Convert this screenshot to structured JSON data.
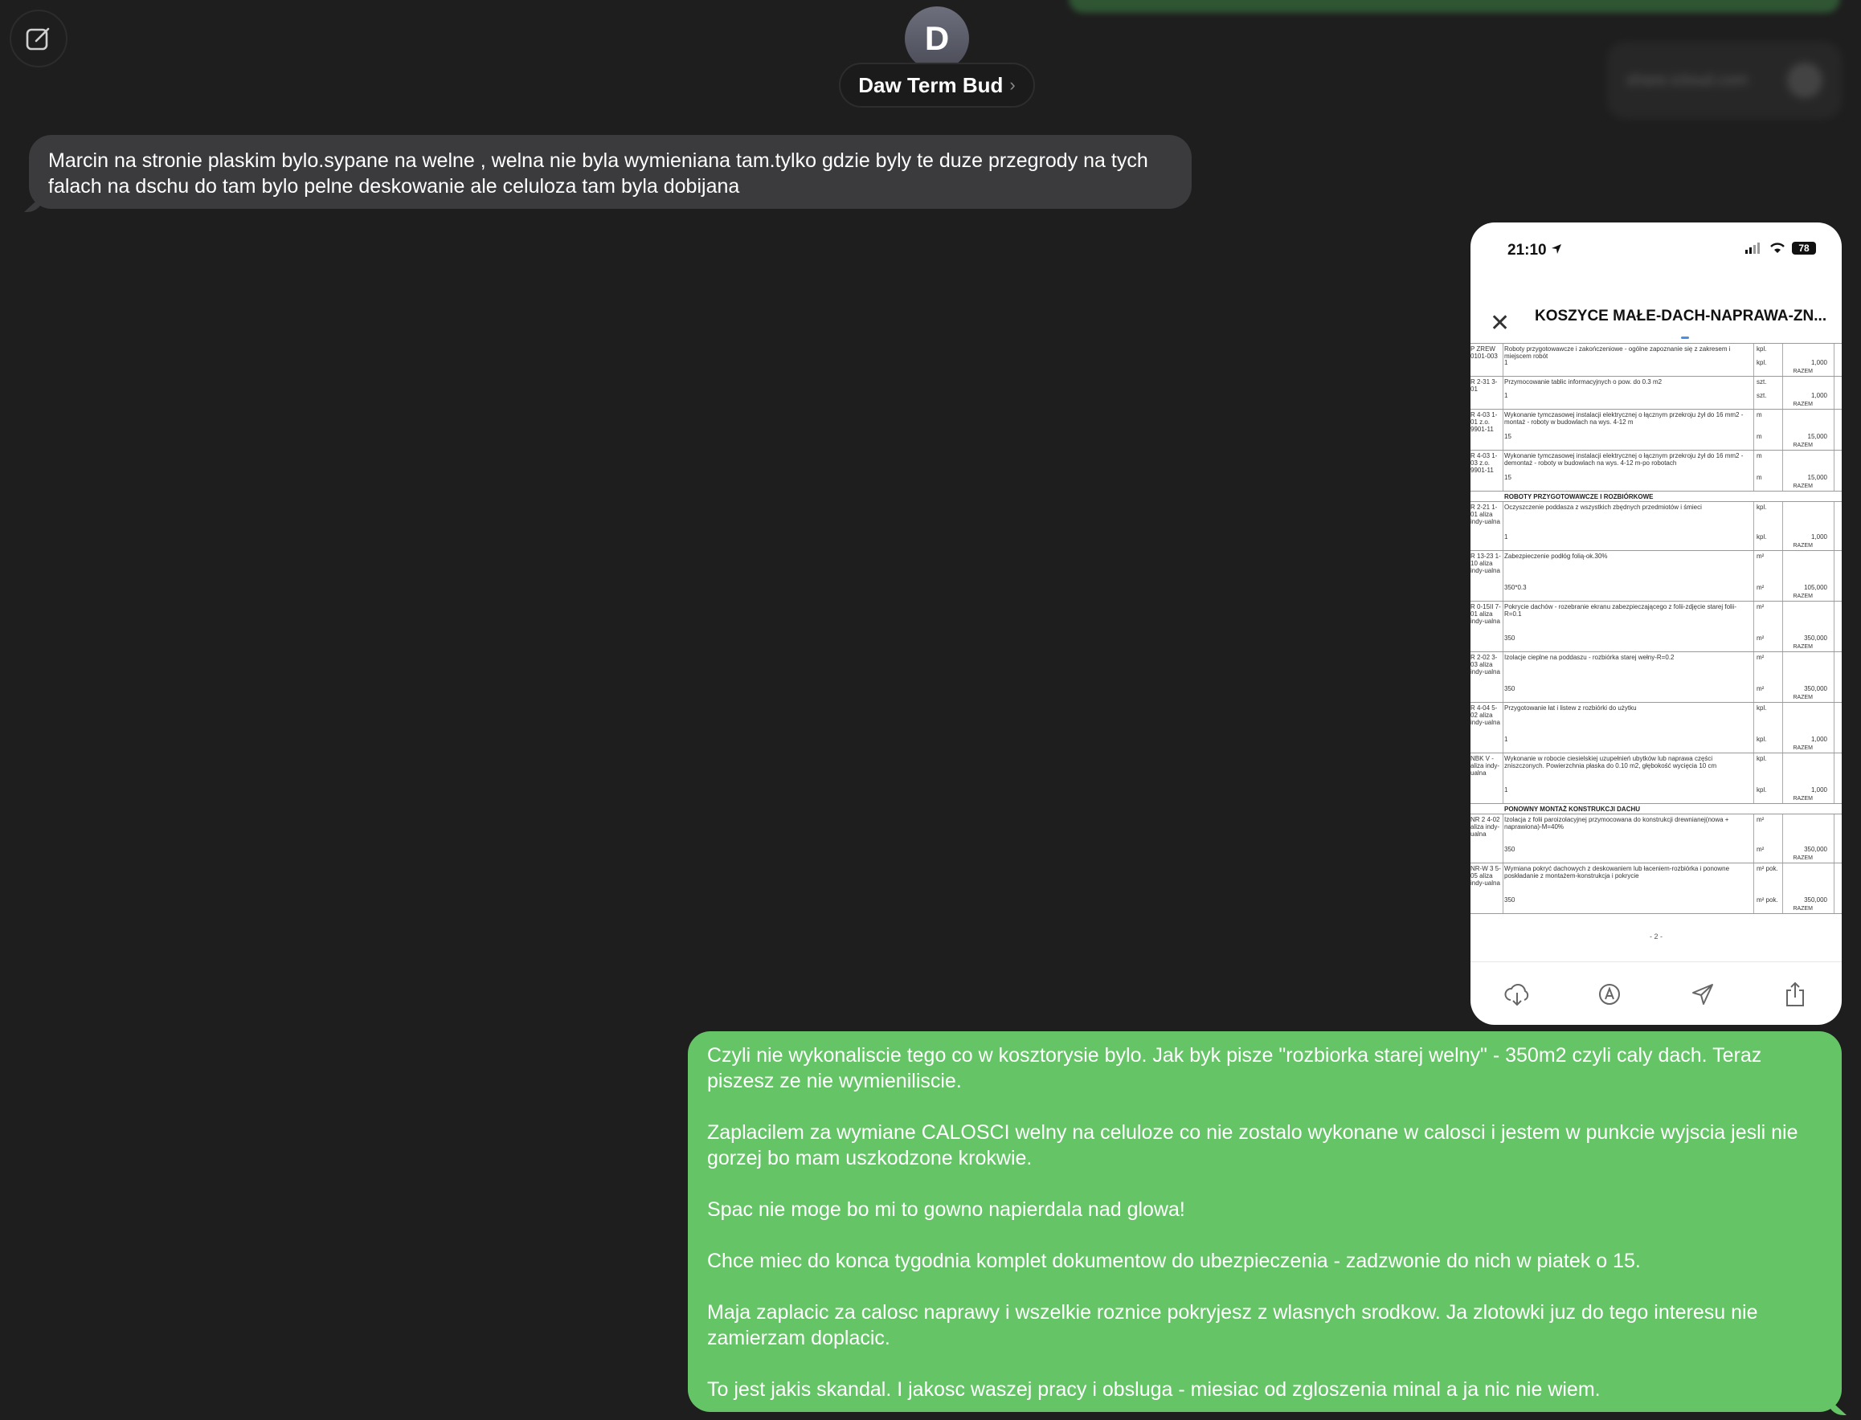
{
  "contact": {
    "initial": "D",
    "name": "Daw Term Bud",
    "chevron": "›"
  },
  "ghost": {
    "link_text": "share.icloud.com"
  },
  "messages": {
    "incoming": "Marcin na stronie plaskim bylo.sypane na welne , welna nie byla wymieniana tam.tylko gdzie byly te duze przegrody na tych falach na dschu do tam bylo pelne deskowanie ale celuloza tam byla dobijana",
    "outgoing": [
      "Czyli nie wykonaliscie tego co w kosztorysie bylo. Jak byk pisze \"rozbiorka starej welny\" - 350m2 czyli caly dach. Teraz piszesz ze nie wymieniliscie.",
      "Zaplacilem za wymiane CALOSCI welny na celuloze co nie zostalo wykonane w calosci i jestem w punkcie wyjscia jesli nie gorzej bo mam uszkodzone krokwie.",
      "Spac nie moge bo mi to gowno napierdala nad glowa!",
      "Chce miec do konca tygodnia komplet dokumentow do ubezpieczenia - zadzwonie do nich w piatek o 15.",
      "Maja zaplacic za calosc naprawy i wszelkie roznice pokryjesz z wlasnych srodkow. Ja zlotowki juz do tego interesu nie zamierzam doplacic.",
      "To jest jakis skandal. I jakosc waszej pracy i obsluga - miesiac od zgloszenia minal a ja nic nie wiem."
    ]
  },
  "phone": {
    "time": "21:10",
    "battery": "78",
    "doc_title": "KOSZYCE MAŁE-DACH-NAPRAWA-ZN...",
    "page_number": "- 2 -",
    "razem": "RAZEM",
    "rows": [
      {
        "code": "P ZREW 0101-003",
        "desc": "Roboty przygotowawcze i zakończeniowe - ogólne zapoznanie się z zakresem i miejscem robót",
        "unit": "kpl.",
        "base": "1",
        "qty": "1,000",
        "h": 40
      },
      {
        "code": "R 2-31 3-01",
        "desc": "Przymocowanie tablic informacyjnych o pow. do 0.3 m2",
        "unit": "szt.",
        "base": "1",
        "qty": "1,000",
        "h": 40
      },
      {
        "code": "R 4-03 1-01 z.o. 9901-11",
        "desc": "Wykonanie tymczasowej instalacji elektrycznej o łącznym przekroju żył do 16 mm2 - montaż - roboty w budowlach na wys. 4-12 m",
        "unit": "m",
        "base": "15",
        "qty": "15,000",
        "h": 50
      },
      {
        "code": "R 4-03 1-03 z.o. 9901-11",
        "desc": "Wykonanie tymczasowej instalacji elektrycznej o łącznym przekroju żył do 16 mm2 - demontaż - roboty w budowlach na wys. 4-12 m-po robotach",
        "unit": "m",
        "base": "15",
        "qty": "15,000",
        "h": 50
      }
    ],
    "section_1": "ROBOTY PRZYGOTOWAWCZE I ROZBIÓRKOWE",
    "rows2": [
      {
        "code": "R 2-21 1-01 aliza indy-ualna",
        "desc": "Oczyszczenie poddasza z wszystkich zbędnych przedmiotów i śmieci",
        "unit": "kpl.",
        "base": "1",
        "qty": "1,000",
        "h": 60
      },
      {
        "code": "R 13-23 1-10 aliza indy-ualna",
        "desc": "Zabezpieczenie podłóg folią-ok.30%",
        "unit": "m²",
        "base": "350*0.3",
        "qty": "105,000",
        "h": 62
      },
      {
        "code": "R 0-15II 7-01 aliza indy-ualna",
        "desc": "Pokrycie dachów - rozebranie ekranu zabezpieczającego z folii-zdjęcie starej folii-R=0.1",
        "unit": "m²",
        "base": "350",
        "qty": "350,000",
        "h": 62
      },
      {
        "code": "R 2-02 3-03 aliza indy-ualna",
        "desc": "Izolacje cieplne na poddaszu - rozbiórka starej wełny-R=0.2",
        "unit": "m²",
        "base": "350",
        "qty": "350,000",
        "h": 62
      },
      {
        "code": "R 4-04 5-02 aliza indy-ualna",
        "desc": "Przygotowanie łat i listew z rozbiórki do użytku",
        "unit": "kpl.",
        "base": "1",
        "qty": "1,000",
        "h": 62
      },
      {
        "code": "NBK V - aliza indy-ualna",
        "desc": "Wykonanie w robocie ciesielskiej uzupełnień ubytków lub naprawa części zniszczonych. Powierzchnia płaska do 0.10 m2, głębokość wycięcia 10 cm",
        "unit": "kpl.",
        "base": "1",
        "qty": "1,000",
        "h": 62
      }
    ],
    "section_2": "PONOWNY MONTAŻ KONSTRUKCJI DACHU",
    "rows3": [
      {
        "code": "NR 2 4-02 aliza indy-ualna",
        "desc": "Izolacja z folii paroizolacyjnej przymocowana do konstrukcji drewnianej(nowa + naprawiona)-M=40%",
        "unit": "m²",
        "base": "350",
        "qty": "350,000",
        "h": 60
      },
      {
        "code": "NR-W 3 5-05 aliza indy-ualna",
        "desc": "Wymiana pokryć dachowych z deskowaniem lub łaceniem-rozbiórka i ponowne poskładanie z montażem-konstrukcja i pokrycie",
        "unit": "m² pok.",
        "base": "350",
        "qty": "350,000",
        "h": 62
      }
    ]
  }
}
